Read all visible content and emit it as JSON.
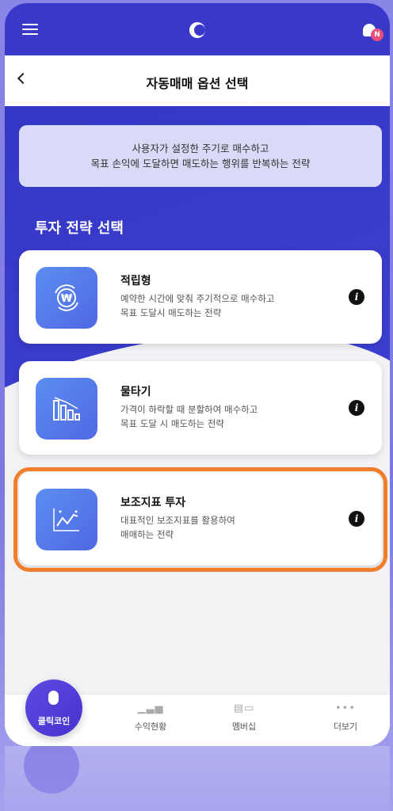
{
  "header": {
    "title": "자동매매 옵션 선택",
    "notification_badge": "N"
  },
  "info": {
    "line1": "사용자가 설정한 주기로 매수하고",
    "line2": "목표 손익에 도달하면 매도하는 행위를 반복하는 전략"
  },
  "section_title": "투자 전략 선택",
  "strategies": [
    {
      "title": "적립형",
      "desc1": "예약한 시간에 맞춰 주기적으로 매수하고",
      "desc2": "목표 도달시 매도하는 전략",
      "icon": "won-cycle-icon"
    },
    {
      "title": "물타기",
      "desc1": "가격이 하락할 때 분할하여 매수하고",
      "desc2": "목표 도달 시 매도하는 전략",
      "icon": "descending-bars-icon"
    },
    {
      "title": "보조지표 투자",
      "desc1": "대표적인 보조지표를 활용하여",
      "desc2": "매매하는 전략",
      "icon": "line-chart-icon",
      "highlighted": true
    }
  ],
  "info_glyph": "i",
  "bottom_nav": {
    "fab_label": "클릭코인",
    "items": [
      "수익현황",
      "멤버십",
      "더보기"
    ]
  },
  "colors": {
    "primary": "#3a38c9",
    "highlight": "#f07e2a",
    "icon_gradient_start": "#5b8ef0",
    "icon_gradient_end": "#5068e4"
  }
}
